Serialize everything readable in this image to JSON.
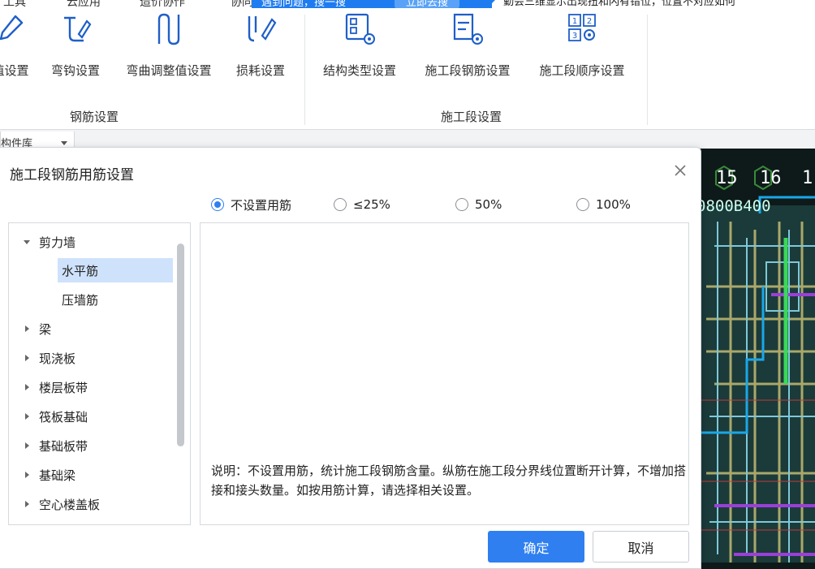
{
  "menubar": {
    "items": [
      "工具",
      "云应用",
      "造价协作",
      "协同"
    ],
    "tip_text": "遇到问题，搜一搜",
    "tip_button": "立即去搜",
    "notice": "勤会三维显示出现扭和闪有错位，位置不对应如何"
  },
  "ribbon": {
    "rebar_group": {
      "label": "钢筋设置",
      "buttons": [
        "值设置",
        "弯钩设置",
        "弯曲调整值设置",
        "损耗设置"
      ]
    },
    "section_group": {
      "label": "施工段设置",
      "buttons": [
        "结构类型设置",
        "施工段钢筋设置",
        "施工段顺序设置"
      ]
    }
  },
  "combo": {
    "text": "构件库"
  },
  "cad": {
    "labels": [
      "15",
      "16",
      "1"
    ],
    "dimension": "0800B400"
  },
  "dialog": {
    "title": "施工段钢筋用筋设置",
    "radio_options": [
      {
        "label": "不设置用筋",
        "checked": true
      },
      {
        "label": "≤25%",
        "checked": false
      },
      {
        "label": "50%",
        "checked": false
      },
      {
        "label": "100%",
        "checked": false
      }
    ],
    "tree": [
      {
        "label": "剪力墙",
        "expanded": true
      },
      {
        "label": "水平筋",
        "child": true,
        "selected": true
      },
      {
        "label": "压墙筋",
        "child": true
      },
      {
        "label": "梁"
      },
      {
        "label": "现浇板"
      },
      {
        "label": "楼层板带"
      },
      {
        "label": "筏板基础"
      },
      {
        "label": "基础板带"
      },
      {
        "label": "基础梁"
      },
      {
        "label": "空心楼盖板"
      }
    ],
    "description": "说明：不设置用筋，统计施工段钢筋含量。纵筋在施工段分界线位置断开计算，不增加搭接和接头数量。如按用筋计算，请选择相关设置。",
    "ok_label": "确定",
    "cancel_label": "取消"
  },
  "colors": {
    "accent": "#2f7ff0",
    "selection": "#cfe2fb",
    "cad_background": "#0e1a1a"
  }
}
